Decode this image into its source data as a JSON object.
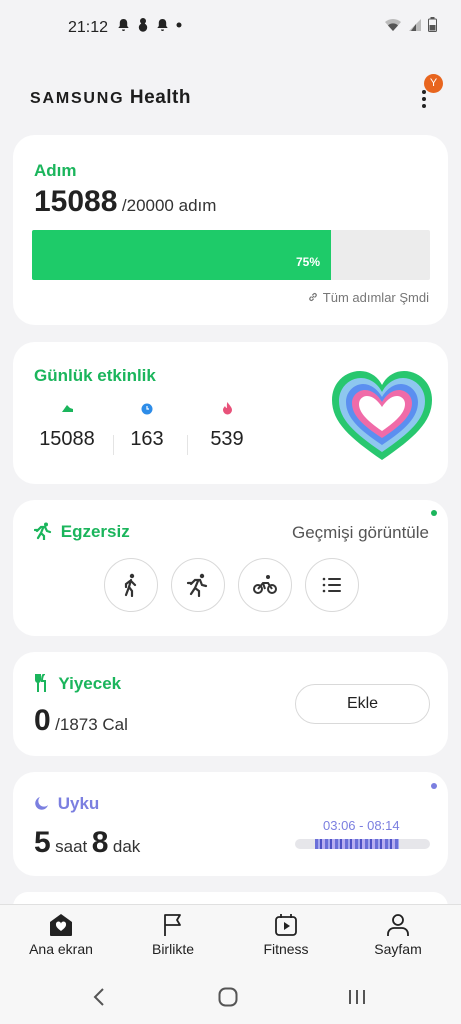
{
  "status_bar": {
    "time": "21:12"
  },
  "header": {
    "brand_samsung": "SAMSUNG",
    "brand_health": "Health",
    "avatar_letter": "Y"
  },
  "steps_card": {
    "title": "Adım",
    "count": "15088",
    "goal": "/20000 adım",
    "progress_fraction": 0.75,
    "progress_label": "75%",
    "link_label": "Tüm adımlar Şmdi"
  },
  "activity_card": {
    "title": "Günlük etkinlik",
    "stats": [
      {
        "icon": "shoe-icon",
        "value": "15088",
        "color": "#1bb55c"
      },
      {
        "icon": "clock-icon",
        "value": "163",
        "color": "#2d8ce8"
      },
      {
        "icon": "flame-icon",
        "value": "539",
        "color": "#e8527a"
      }
    ]
  },
  "exercise_card": {
    "title": "Egzersiz",
    "history_label": "Geçmişi görüntüle",
    "buttons": [
      "walk-icon",
      "run-icon",
      "bike-icon",
      "list-icon"
    ]
  },
  "food_card": {
    "title": "Yiyecek",
    "value": "0",
    "goal": "/1873 Cal",
    "add_label": "Ekle"
  },
  "sleep_card": {
    "title": "Uyku",
    "hours": "5",
    "hours_unit": "saat",
    "minutes": "8",
    "minutes_unit": "dak",
    "range": "03:06 - 08:14"
  },
  "bottom_nav": [
    {
      "label": "Ana ekran",
      "icon": "home-heart-icon"
    },
    {
      "label": "Birlikte",
      "icon": "flag-icon"
    },
    {
      "label": "Fitness",
      "icon": "fitness-play-icon"
    },
    {
      "label": "Sayfam",
      "icon": "person-icon"
    }
  ],
  "colors": {
    "green": "#1bb55c",
    "bar_green": "#1ecb69",
    "sleep_purple": "#7b7fe0"
  }
}
